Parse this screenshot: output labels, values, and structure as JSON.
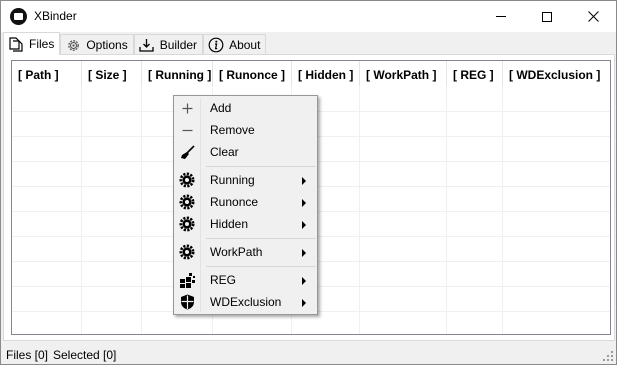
{
  "window": {
    "title": "XBinder"
  },
  "tabs": [
    {
      "label": "Files",
      "icon": "files-icon"
    },
    {
      "label": "Options",
      "icon": "gear-icon"
    },
    {
      "label": "Builder",
      "icon": "builder-icon"
    },
    {
      "label": "About",
      "icon": "info-icon"
    }
  ],
  "table": {
    "columns": [
      "[ Path ]",
      "[ Size ]",
      "[ Running ]",
      "[ Runonce ]",
      "[ Hidden ]",
      "[ WorkPath ]",
      "[ REG ]",
      "[ WDExclusion ]"
    ],
    "rows": []
  },
  "context_menu": {
    "items": [
      {
        "label": "Add",
        "icon": "plus-icon"
      },
      {
        "label": "Remove",
        "icon": "minus-icon"
      },
      {
        "label": "Clear",
        "icon": "broom-icon"
      },
      {
        "label": "Running",
        "icon": "gear-icon",
        "submenu": true
      },
      {
        "label": "Runonce",
        "icon": "gear-icon",
        "submenu": true
      },
      {
        "label": "Hidden",
        "icon": "gear-icon",
        "submenu": true
      },
      {
        "label": "WorkPath",
        "icon": "gear-icon",
        "submenu": true
      },
      {
        "label": "REG",
        "icon": "registry-icon",
        "submenu": true
      },
      {
        "label": "WDExclusion",
        "icon": "shield-icon",
        "submenu": true
      }
    ]
  },
  "status": {
    "files": "Files [0]",
    "selected": "Selected [0]"
  }
}
